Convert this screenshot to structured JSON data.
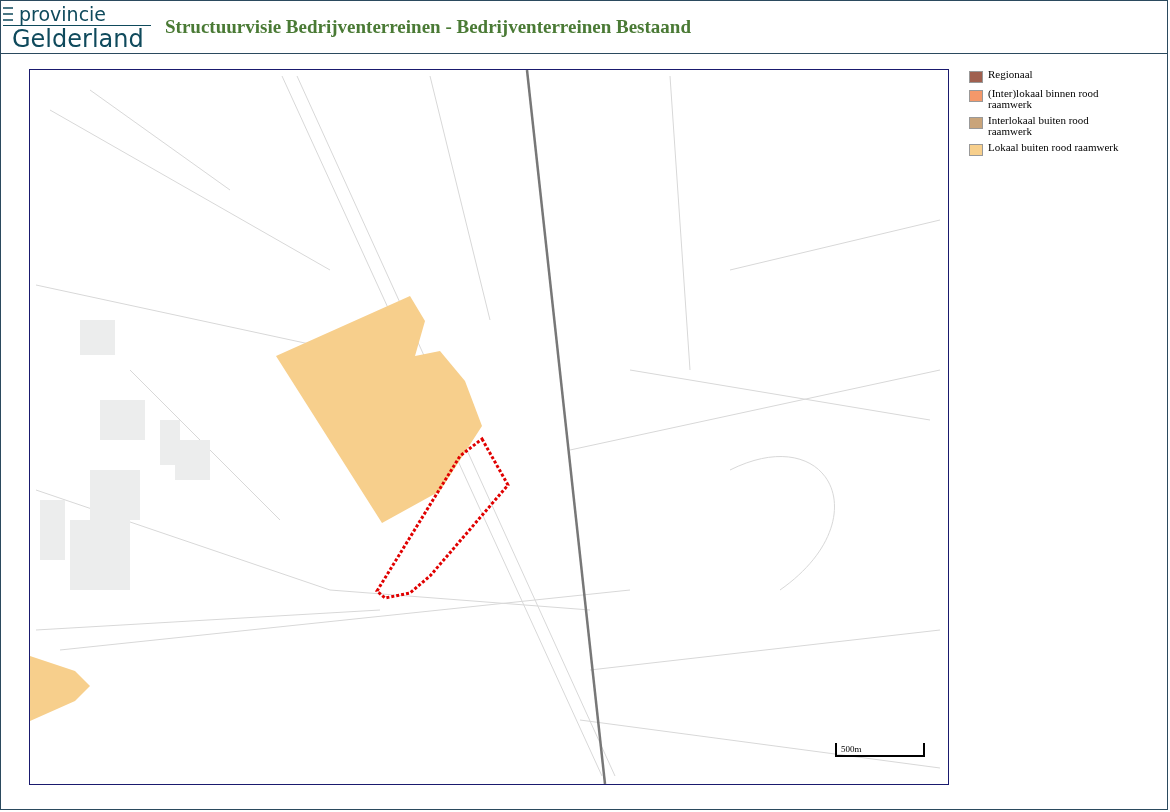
{
  "header": {
    "logo": {
      "line_1": "provincie",
      "line_2": "Gelderland"
    },
    "title": "Structuurvisie Bedrijventerreinen - Bedrijventerreinen Bestaand"
  },
  "map": {
    "scale_label": "500m"
  },
  "legend": [
    {
      "label": "Regionaal",
      "color": "#a0604f"
    },
    {
      "label": "(Inter)lokaal binnen rood raamwerk",
      "color": "#f4986a"
    },
    {
      "label": "Interlokaal buiten rood raamwerk",
      "color": "#c9a47a"
    },
    {
      "label": "Lokaal buiten rood raamwerk",
      "color": "#f7cf8c"
    }
  ]
}
